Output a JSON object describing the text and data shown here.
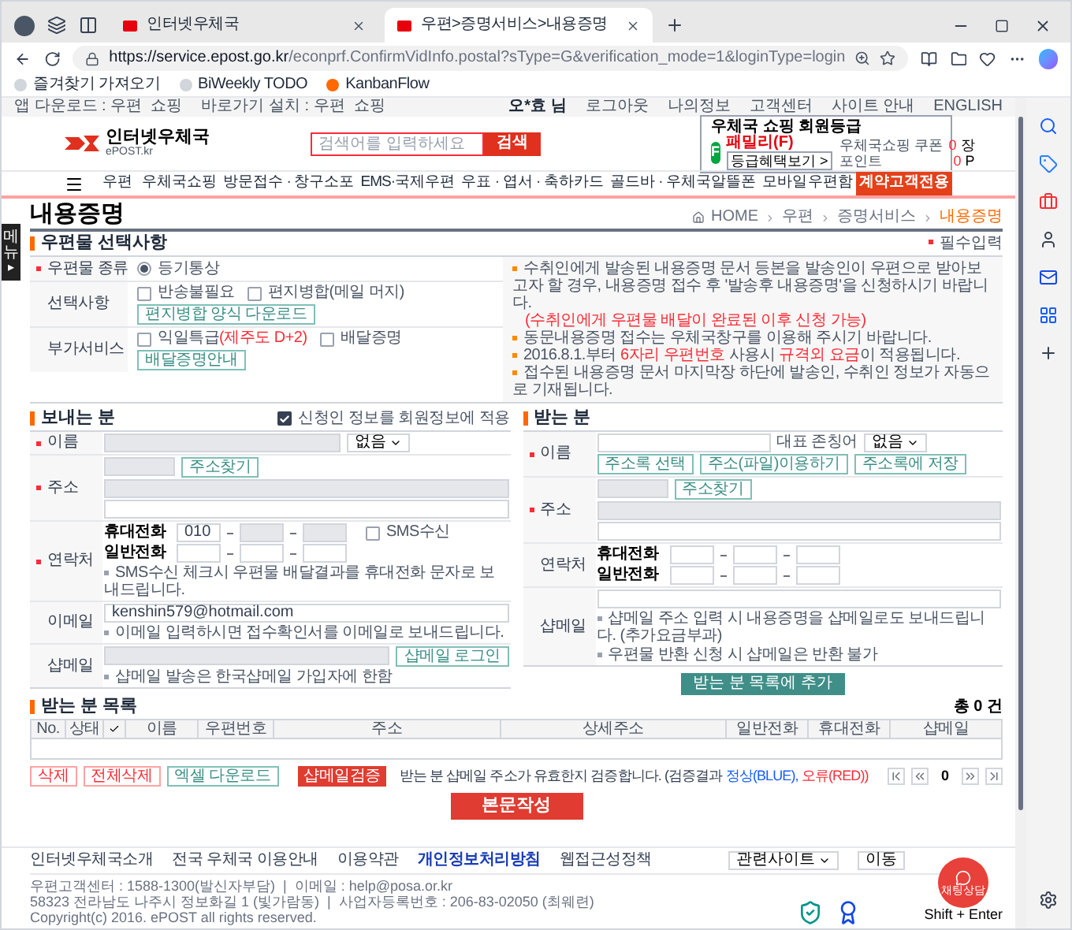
{
  "browser": {
    "tabs": [
      {
        "label": "인터넷우체국",
        "selected": false
      },
      {
        "label": "우편>증명서비스>내용증명",
        "selected": true
      }
    ],
    "url_host": "https://service.epost.go.kr",
    "url_path": "/econprf.ConfirmVidInfo.postal?sType=G&verification_mode=1&loginType=login",
    "bookmarks": [
      "즐겨찾기 가져오기",
      "BiWeekly TODO",
      "KanbanFlow"
    ]
  },
  "util_bar": {
    "left": [
      "앱 다운로드 : 우편  쇼핑",
      "바로가기 설치 : 우편  쇼핑"
    ],
    "user": "오*효 님",
    "right": [
      "로그아웃",
      "나의정보",
      "고객센터",
      "사이트 안내",
      "ENGLISH"
    ]
  },
  "header": {
    "logo": "인터넷우체국",
    "logo_sub": "ePOST.kr",
    "search": {
      "placeholder": "검색어를 입력하세요",
      "button": "검색"
    },
    "member": {
      "title": "우체국 쇼핑 회원등급",
      "grade_letter": "F",
      "grade": "패밀리(F)",
      "benefit_button": "등급혜택보기 >",
      "stats": [
        {
          "label": "우체국쇼핑 쿠폰",
          "value": "0",
          "unit": "장"
        },
        {
          "label": "포인트",
          "value": "0",
          "unit": "P"
        }
      ]
    }
  },
  "nav": [
    {
      "label": "우편",
      "highlighted": false
    },
    {
      "label": "우체국쇼핑",
      "highlighted": false
    },
    {
      "label": "방문접수 · 창구소포",
      "highlighted": false
    },
    {
      "label": "EMS·국제우편",
      "highlighted": false
    },
    {
      "label": "우표 · 엽서 · 축하카드",
      "highlighted": false
    },
    {
      "label": "골드바 · 우체국알뜰폰",
      "highlighted": false
    },
    {
      "label": "모바일우편함",
      "highlighted": false
    },
    {
      "label": "계약고객전용",
      "highlighted": true
    }
  ],
  "side_tab": {
    "label": "메뉴",
    "arrow": "▸"
  },
  "page": {
    "title": "내용증명",
    "breadcrumb": [
      "HOME",
      "우편",
      "증명서비스",
      "내용증명"
    ]
  },
  "options": {
    "heading": "우편물 선택사항",
    "required_note": "필수입력",
    "rows": [
      {
        "label": "우편물 종류",
        "required": true,
        "controls": [
          {
            "kind": "radio",
            "label": "등기통상",
            "selected": true
          }
        ]
      },
      {
        "label": "선택사항",
        "required": false,
        "controls": [
          {
            "kind": "checkbox",
            "label": "반송불필요",
            "checked": false
          },
          {
            "kind": "checkbox",
            "label": "편지병합(메일 머지)",
            "checked": false
          },
          {
            "kind": "button",
            "label": "편지병합 양식 다운로드"
          }
        ]
      },
      {
        "label": "부가서비스",
        "required": false,
        "controls": [
          {
            "kind": "checkbox",
            "label": "익일특급",
            "note": "(제주도 D+2)",
            "checked": false
          },
          {
            "kind": "checkbox",
            "label": "배달증명",
            "checked": false
          },
          {
            "kind": "button",
            "label": "배달증명안내"
          }
        ]
      }
    ],
    "notes": [
      {
        "kind": "bullet",
        "text": "수취인에게 발송된 내용증명 문서 등본을 발송인이 우편으로 받아보고자 할 경우, 내용증명 접수 후 '발송후 내용증명'을 신청하시기 바랍니다."
      },
      {
        "kind": "alert",
        "text": "(수취인에게 우편물 배달이 완료된 이후 신청 가능)"
      },
      {
        "kind": "bullet",
        "text": "동문내용증명 접수는 우체국창구를 이용해 주시기 바랍니다."
      },
      {
        "kind": "bullet",
        "text": "2016.8.1.부터 **6자리 우편번호** 사용시 **규격외 요금**이 적용됩니다."
      },
      {
        "kind": "bullet",
        "text": "접수된 내용증명 문서 마지막장 하단에 발송인, 수취인 정보가 자동으로 기재됩니다."
      }
    ]
  },
  "sender": {
    "heading": "보내는 분",
    "apply_member": {
      "label": "신청인 정보를 회원정보에 적용",
      "checked": true
    },
    "name": {
      "label": "이름",
      "required": true,
      "honorific": "없음"
    },
    "address": {
      "label": "주소",
      "required": true,
      "button": "주소찾기"
    },
    "contact": {
      "label": "연락처",
      "required": true,
      "mobile_label": "휴대전화",
      "mobile_prefix": "010",
      "sms": {
        "label": "SMS수신",
        "checked": false
      },
      "phone_label": "일반전화",
      "note": "SMS수신 체크시 우편물 배달결과를 휴대전화 문자로 보내드립니다."
    },
    "email": {
      "label": "이메일",
      "required": false,
      "value": "kenshin579@hotmail.com",
      "note": "이메일 입력하시면 접수확인서를 이메일로 보내드립니다."
    },
    "shopmail": {
      "label": "샵메일",
      "required": false,
      "button": "샵메일 로그인",
      "note": "샵메일 발송은 한국샵메일 가입자에 한함"
    }
  },
  "receiver": {
    "heading": "받는 분",
    "name": {
      "label": "이름",
      "required": true,
      "honorific_label": "대표 존칭어",
      "honorific": "없음"
    },
    "buttons": [
      "주소록 선택",
      "주소(파일)이용하기",
      "주소록에 저장"
    ],
    "address": {
      "label": "주소",
      "required": true,
      "button": "주소찾기"
    },
    "contact": {
      "label": "연락처",
      "required": false,
      "mobile_label": "휴대전화",
      "phone_label": "일반전화"
    },
    "shopmail": {
      "label": "샵메일",
      "required": false,
      "notes": [
        "샵메일 주소 입력 시 내용증명을 샵메일로도 보내드립니다. (추가요금부과)",
        "우편물 반환 신청 시 샵메일은 반환 불가"
      ]
    },
    "add_button": "받는 분 목록에 추가"
  },
  "list": {
    "heading": "받는 분 목록",
    "count": "총 0 건",
    "columns": [
      {
        "kind": "text",
        "label": "No."
      },
      {
        "kind": "text",
        "label": "상태"
      },
      {
        "kind": "check"
      },
      {
        "kind": "text",
        "label": "이름"
      },
      {
        "kind": "text",
        "label": "우편번호"
      },
      {
        "kind": "text",
        "label": "주소"
      },
      {
        "kind": "text",
        "label": "상세주소"
      },
      {
        "kind": "text",
        "label": "일반전화"
      },
      {
        "kind": "text",
        "label": "휴대전화"
      },
      {
        "kind": "text",
        "label": "샵메일"
      }
    ],
    "buttons": [
      {
        "kind": "red-outline",
        "label": "삭제"
      },
      {
        "kind": "red-outline",
        "label": "전체삭제"
      },
      {
        "kind": "teal-outline",
        "label": "엑셀 다운로드"
      },
      {
        "kind": "red",
        "label": "샵메일검증"
      }
    ],
    "verify_note": [
      {
        "kind": "plain",
        "text": "받는 분 샵메일 주소가 유효한지 검증합니다. (검증결과"
      },
      {
        "kind": "ok",
        "text": "정상(BLUE),"
      },
      {
        "kind": "error",
        "text": "오류(RED))"
      }
    ],
    "page": "0"
  },
  "submit": "본문작성",
  "footer": {
    "links": [
      {
        "label": "인터넷우체국소개",
        "emphasized": false
      },
      {
        "label": "전국 우체국 이용안내",
        "emphasized": false
      },
      {
        "label": "이용약관",
        "emphasized": false
      },
      {
        "label": "개인정보처리방침",
        "emphasized": true
      },
      {
        "label": "웹접근성정책",
        "emphasized": false
      }
    ],
    "related": "관련사이트",
    "go": "이동",
    "info": [
      "우편고객센터 : 1588-1300(발신자부담)  |  이메일 : help@posa.or.kr",
      "58323 전라남도 나주시 정보화길 1 (빛가람동)  |  사업자등록번호 : 206-83-02050 (최웨련)",
      "Copyright(c) 2016. ePOST all rights reserved."
    ]
  },
  "chat": {
    "label": "채팅상담",
    "shortcut": "Shift + Enter"
  }
}
